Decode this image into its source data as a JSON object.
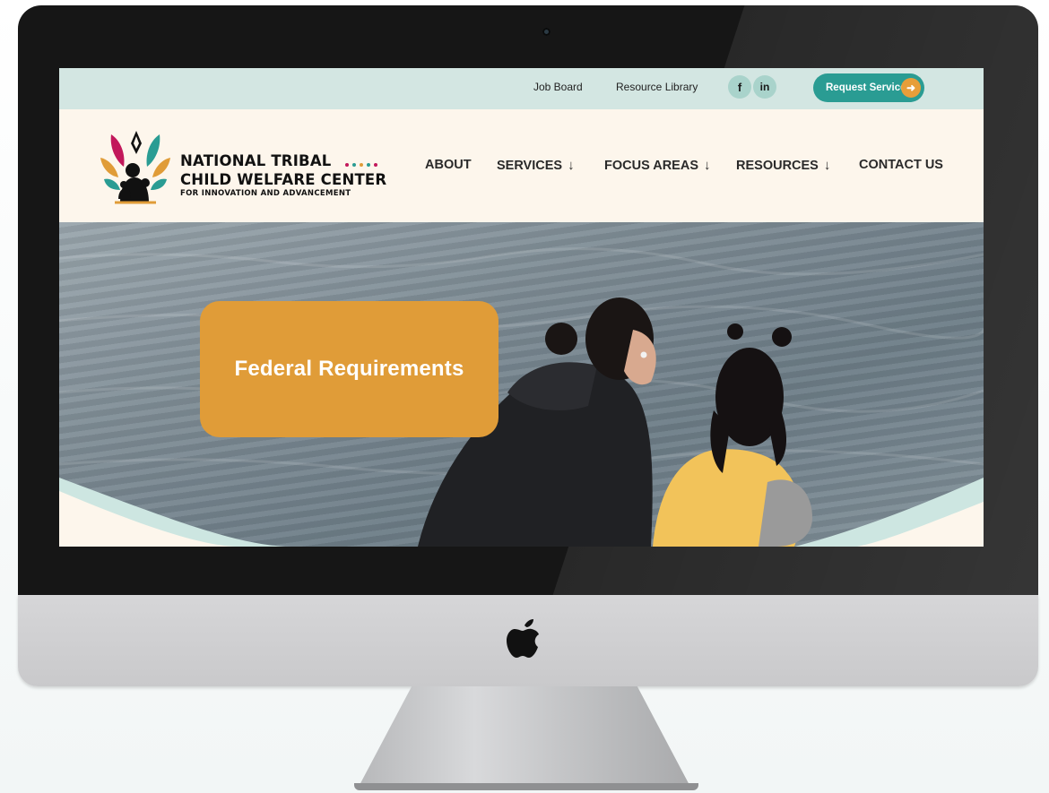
{
  "utility_bar": {
    "links": [
      {
        "label": "Job Board"
      },
      {
        "label": "Resource Library"
      }
    ],
    "social": [
      {
        "icon": "facebook-icon",
        "glyph": "f"
      },
      {
        "icon": "linkedin-icon",
        "glyph": "in"
      }
    ],
    "cta": {
      "label": "Request Services",
      "icon": "arrow-right-icon"
    }
  },
  "logo": {
    "line1": "NATIONAL TRIBAL",
    "line2": "CHILD WELFARE CENTER",
    "line3": "FOR INNOVATION AND ADVANCEMENT"
  },
  "nav": {
    "items": [
      {
        "label": "ABOUT",
        "has_dropdown": false
      },
      {
        "label": "SERVICES",
        "has_dropdown": true
      },
      {
        "label": "FOCUS AREAS",
        "has_dropdown": true
      },
      {
        "label": "RESOURCES",
        "has_dropdown": true
      },
      {
        "label": "CONTACT US",
        "has_dropdown": false
      }
    ]
  },
  "hero": {
    "title": "Federal Requirements"
  },
  "colors": {
    "utility_bg": "#d3e6e2",
    "page_bg": "#fdf6ec",
    "teal": "#2a9c93",
    "orange": "#e09c38"
  }
}
